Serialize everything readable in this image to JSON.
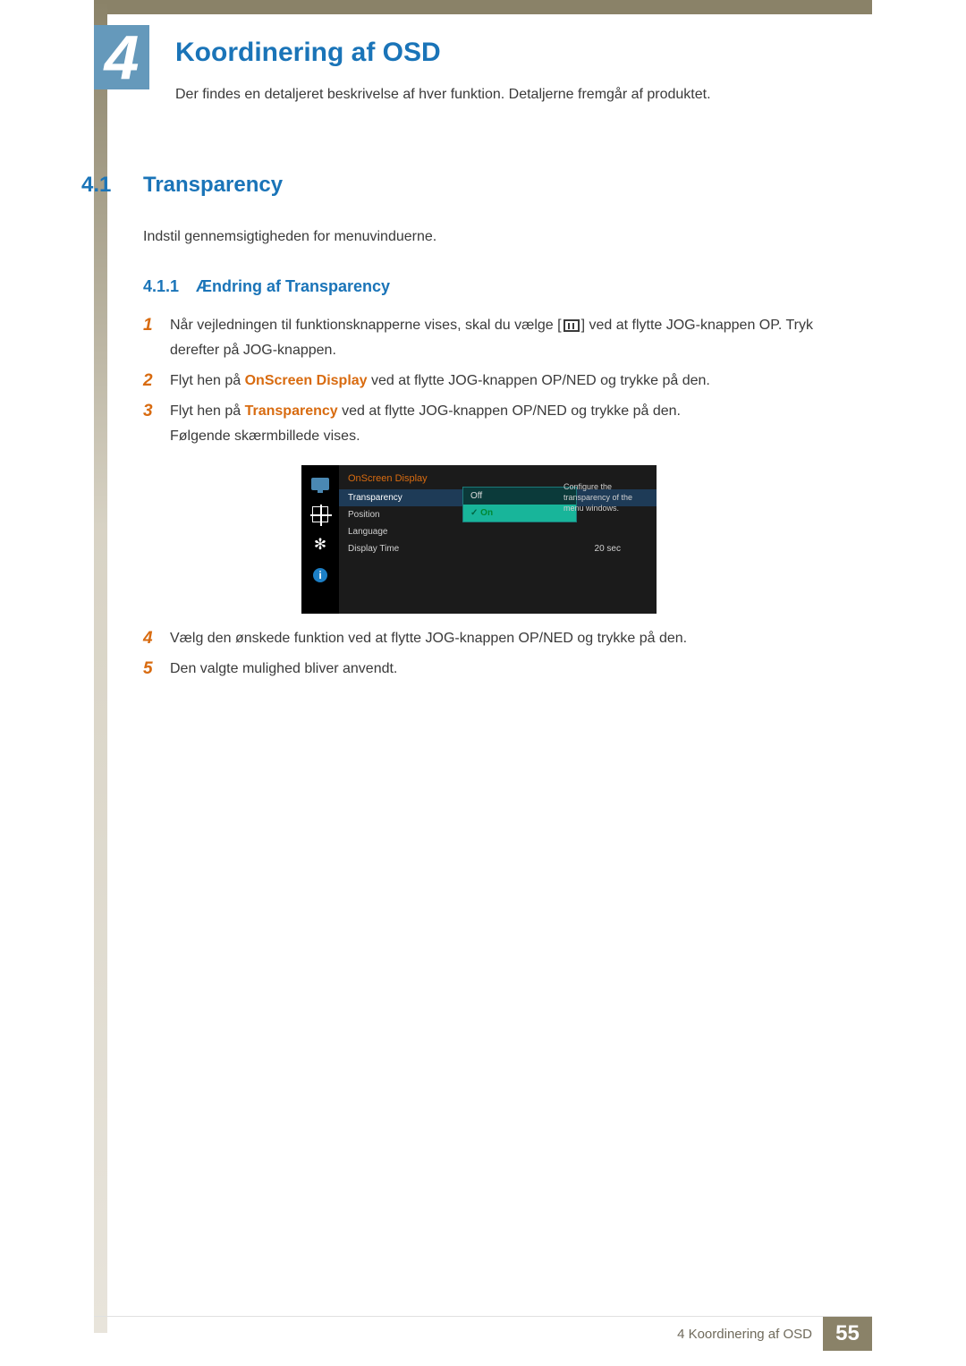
{
  "chapter": {
    "number": "4",
    "title": "Koordinering af OSD",
    "intro": "Der findes en detaljeret beskrivelse af hver funktion. Detaljerne fremgår af produktet."
  },
  "section": {
    "number": "4.1",
    "title": "Transparency",
    "intro": "Indstil gennemsigtigheden for menuvinduerne."
  },
  "subsection": {
    "number": "4.1.1",
    "title": "Ændring af Transparency"
  },
  "steps_a": {
    "s1_num": "1",
    "s1_a": "Når vejledningen til funktionsknapperne vises, skal du vælge [",
    "s1_b": "] ved at flytte JOG-knappen OP. Tryk derefter på JOG-knappen.",
    "s2_num": "2",
    "s2_a": "Flyt hen på ",
    "s2_hot": "OnScreen Display",
    "s2_b": " ved at flytte JOG-knappen OP/NED og trykke på den.",
    "s3_num": "3",
    "s3_a": "Flyt hen på ",
    "s3_hot": "Transparency",
    "s3_b": " ved at flytte JOG-knappen OP/NED og trykke på den.",
    "s3_c": "Følgende skærmbillede vises."
  },
  "steps_b": {
    "s4_num": "4",
    "s4": "Vælg den ønskede funktion ved at flytte JOG-knappen OP/NED og trykke på den.",
    "s5_num": "5",
    "s5": "Den valgte mulighed bliver anvendt."
  },
  "osd": {
    "header": "OnScreen Display",
    "items": {
      "transparency": "Transparency",
      "position": "Position",
      "language": "Language",
      "display_time": "Display Time"
    },
    "display_time_value": "20 sec",
    "options": {
      "off": "Off",
      "on": "On"
    },
    "desc": "Configure the transparency of the menu windows."
  },
  "footer": {
    "text": "4 Koordinering af OSD",
    "page": "55"
  }
}
